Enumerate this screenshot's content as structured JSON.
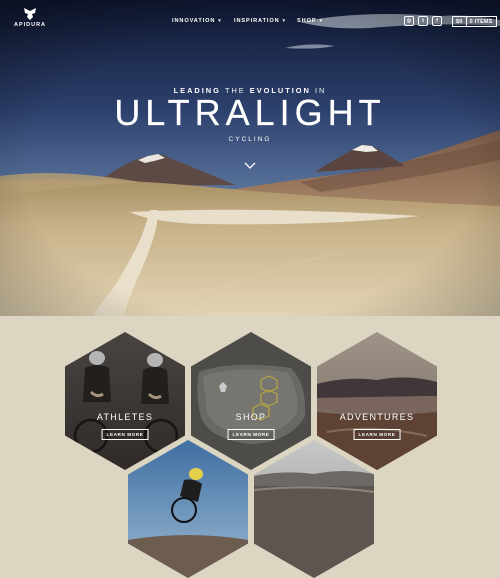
{
  "brand": {
    "name": "APIDURA"
  },
  "nav": {
    "items": [
      {
        "label": "INNOVATION"
      },
      {
        "label": "INSPIRATION"
      },
      {
        "label": "SHOP"
      }
    ],
    "social": [
      {
        "icon": "instagram-icon",
        "glyph": "◎"
      },
      {
        "icon": "twitter-icon",
        "glyph": "t"
      },
      {
        "icon": "facebook-icon",
        "glyph": "f"
      }
    ],
    "cart": {
      "amount": "$0",
      "items": "0 ITEMS"
    }
  },
  "hero": {
    "tagline": {
      "part1": "LEADING ",
      "part2": "THE ",
      "part3": "EVOLUTION ",
      "part4": "IN"
    },
    "headline": "ULTRALIGHT",
    "subline": "CYCLING"
  },
  "tiles": [
    {
      "title": "ATHLETES",
      "button": "LEARN MORE"
    },
    {
      "title": "SHOP",
      "button": "LEARN MORE"
    },
    {
      "title": "ADVENTURES",
      "button": "LEARN MORE"
    }
  ],
  "colors": {
    "sky_top": "#141e3a",
    "sky_mid": "#5f7ea8",
    "desert": "#cbb48a",
    "page_bg": "#dcd5c2"
  }
}
